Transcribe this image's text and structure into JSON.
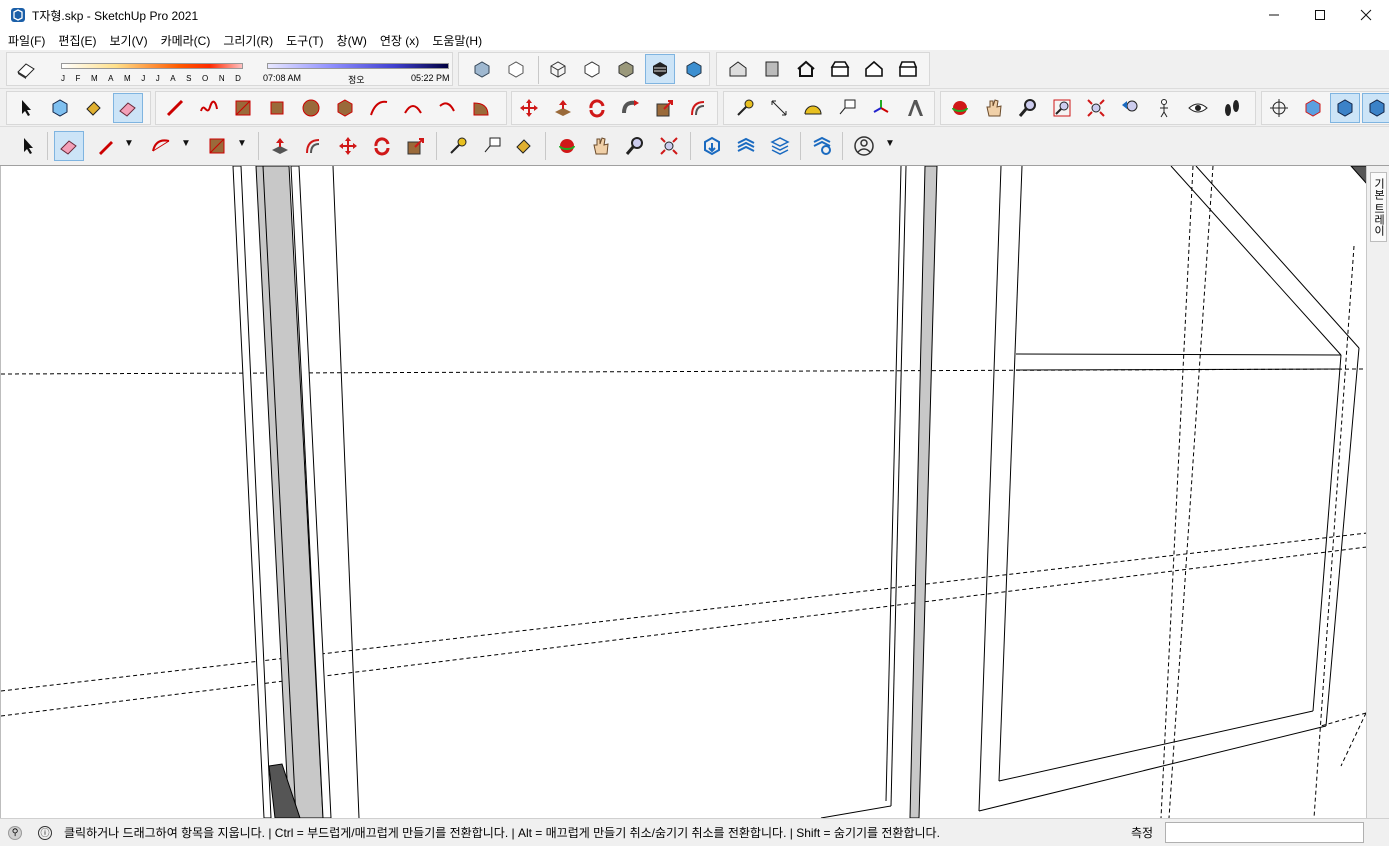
{
  "window": {
    "title": "T자형.skp - SketchUp Pro 2021",
    "min_icon": "minimize-icon",
    "max_icon": "maximize-icon",
    "close_icon": "close-icon"
  },
  "menu": [
    {
      "label": "파일(F)"
    },
    {
      "label": "편집(E)"
    },
    {
      "label": "보기(V)"
    },
    {
      "label": "카메라(C)"
    },
    {
      "label": "그리기(R)"
    },
    {
      "label": "도구(T)"
    },
    {
      "label": "창(W)"
    },
    {
      "label": "연장 (x)"
    },
    {
      "label": "도움말(H)"
    }
  ],
  "shadows": {
    "months": [
      "J",
      "F",
      "M",
      "A",
      "M",
      "J",
      "J",
      "A",
      "S",
      "O",
      "N",
      "D"
    ],
    "time_start": "07:08 AM",
    "time_mid": "정오",
    "time_end": "05:22 PM"
  },
  "tray": {
    "label": "기본 트레이"
  },
  "status": {
    "message": "클릭하거나 드래그하여 항목을 지웁니다. | Ctrl = 부드럽게/매끄럽게 만들기를 전환합니다. | Alt = 매끄럽게 만들기 취소/숨기기 취소를 전환합니다. | Shift = 숨기기를 전환합니다.",
    "measure_label": "측정",
    "measure_value": ""
  },
  "colors": {
    "accent_select": "#cce4f7",
    "red_tool": "#cc1f1f",
    "brown_tool": "#9a6a3a"
  }
}
